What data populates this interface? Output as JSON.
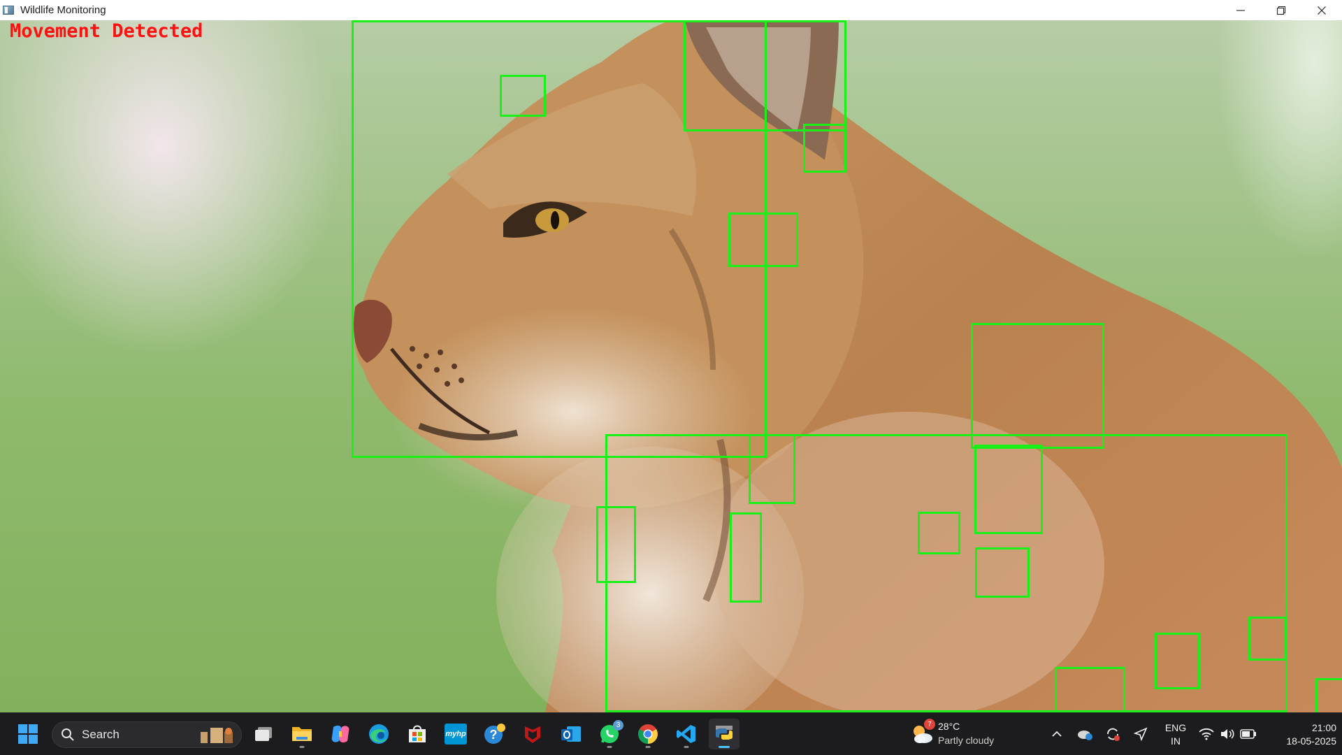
{
  "window": {
    "title": "Wildlife Monitoring",
    "controls": [
      "minimize",
      "restore",
      "close"
    ]
  },
  "overlay": {
    "status_text": "Movement Detected",
    "status_color": "#ff1111",
    "box_color": "#18f018",
    "detection_count": 21
  },
  "taskbar": {
    "search_label": "Search",
    "pinned": [
      {
        "name": "start",
        "icon": "windows-logo-icon"
      },
      {
        "name": "task-view",
        "icon": "task-view-icon"
      },
      {
        "name": "file-explorer",
        "icon": "folder-icon"
      },
      {
        "name": "copilot",
        "icon": "copilot-icon"
      },
      {
        "name": "edge",
        "icon": "edge-icon"
      },
      {
        "name": "microsoft-store",
        "icon": "store-icon"
      },
      {
        "name": "myhp",
        "icon": "myhp-icon",
        "text": "myhp"
      },
      {
        "name": "get-help",
        "icon": "help-icon"
      },
      {
        "name": "mcafee",
        "icon": "mcafee-icon"
      },
      {
        "name": "outlook",
        "icon": "outlook-icon"
      },
      {
        "name": "whatsapp",
        "icon": "whatsapp-icon",
        "badge": "3"
      },
      {
        "name": "chrome",
        "icon": "chrome-icon"
      },
      {
        "name": "vscode",
        "icon": "vscode-icon"
      },
      {
        "name": "python",
        "icon": "python-icon"
      }
    ],
    "weather": {
      "temp": "28°C",
      "desc": "Partly cloudy",
      "alert_badge": "7"
    },
    "tray": {
      "lang_line1": "ENG",
      "lang_line2": "IN",
      "time": "21:00",
      "date": "18-05-2025"
    }
  }
}
